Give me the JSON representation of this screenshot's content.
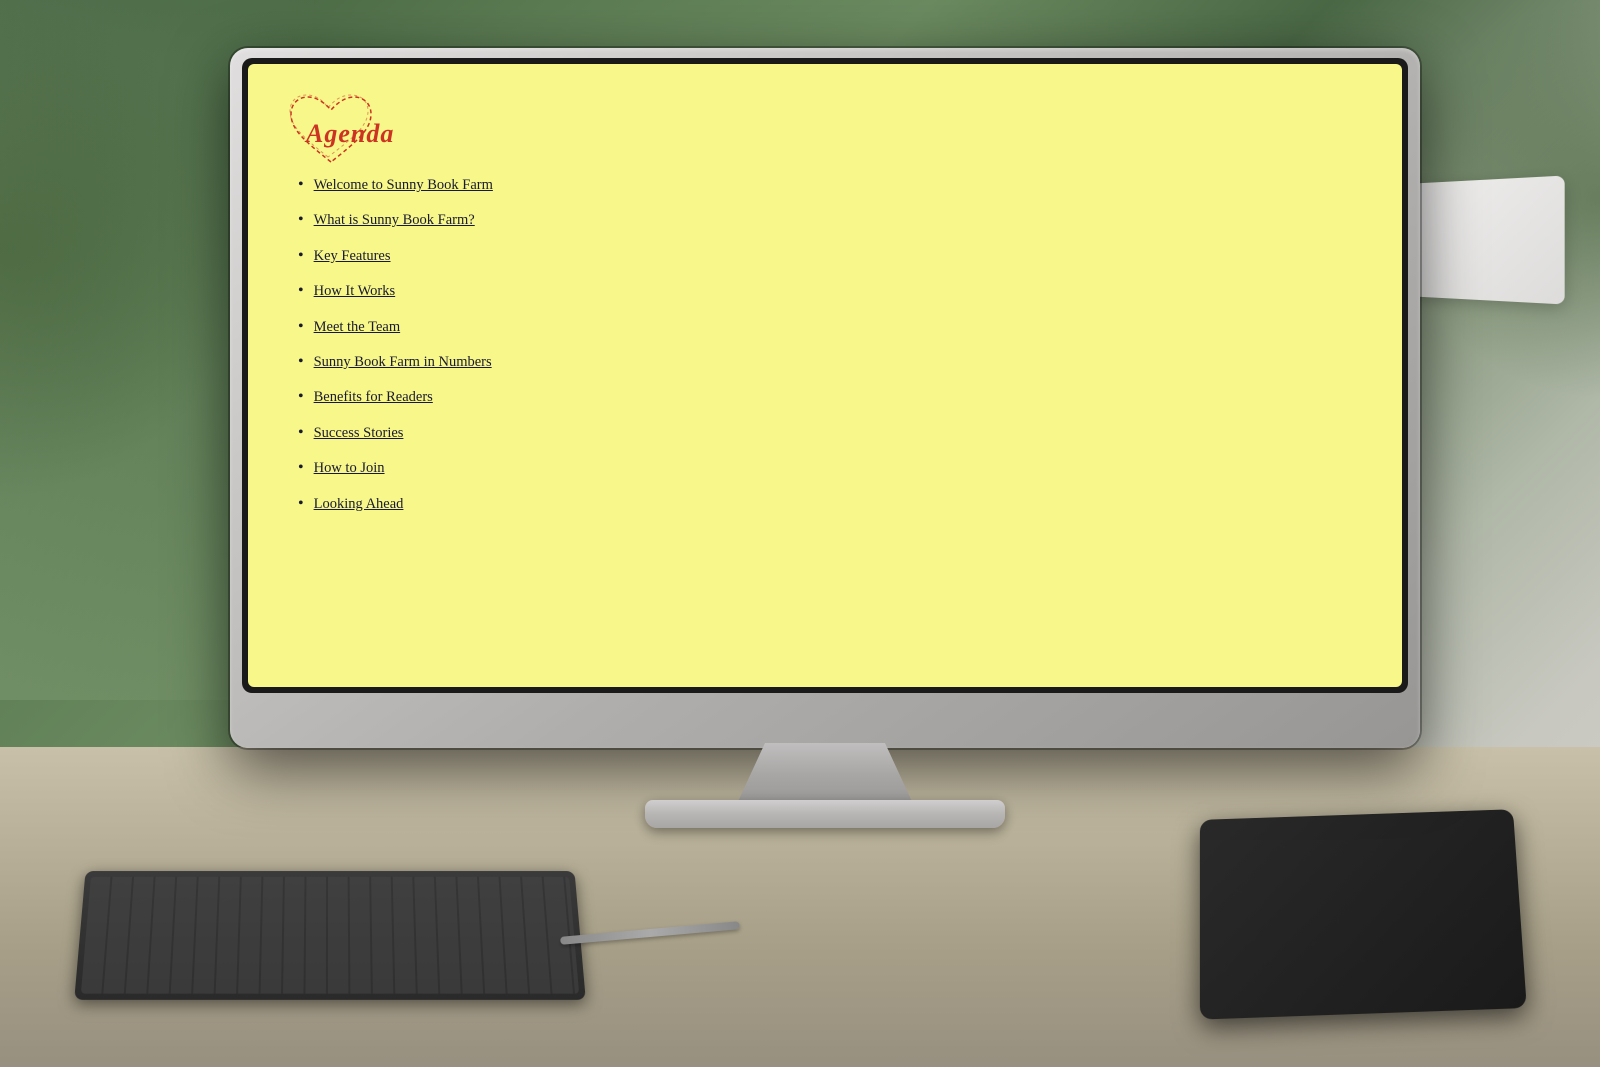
{
  "slide": {
    "background_color": "#f7f78a",
    "title": "Agenda",
    "title_color": "#cc3322",
    "agenda_items": [
      {
        "id": "item-1",
        "label": "Welcome to Sunny Book Farm"
      },
      {
        "id": "item-2",
        "label": "What is Sunny Book Farm?"
      },
      {
        "id": "item-3",
        "label": "Key Features"
      },
      {
        "id": "item-4",
        "label": "How It Works"
      },
      {
        "id": "item-5",
        "label": "Meet the Team"
      },
      {
        "id": "item-6",
        "label": "Sunny Book Farm in Numbers"
      },
      {
        "id": "item-7",
        "label": "Benefits for Readers"
      },
      {
        "id": "item-8",
        "label": "Success Stories"
      },
      {
        "id": "item-9",
        "label": "How to Join"
      },
      {
        "id": "item-10",
        "label": "Looking Ahead"
      }
    ],
    "bullet_char": "•"
  },
  "monitor": {
    "apple_logo": ""
  }
}
